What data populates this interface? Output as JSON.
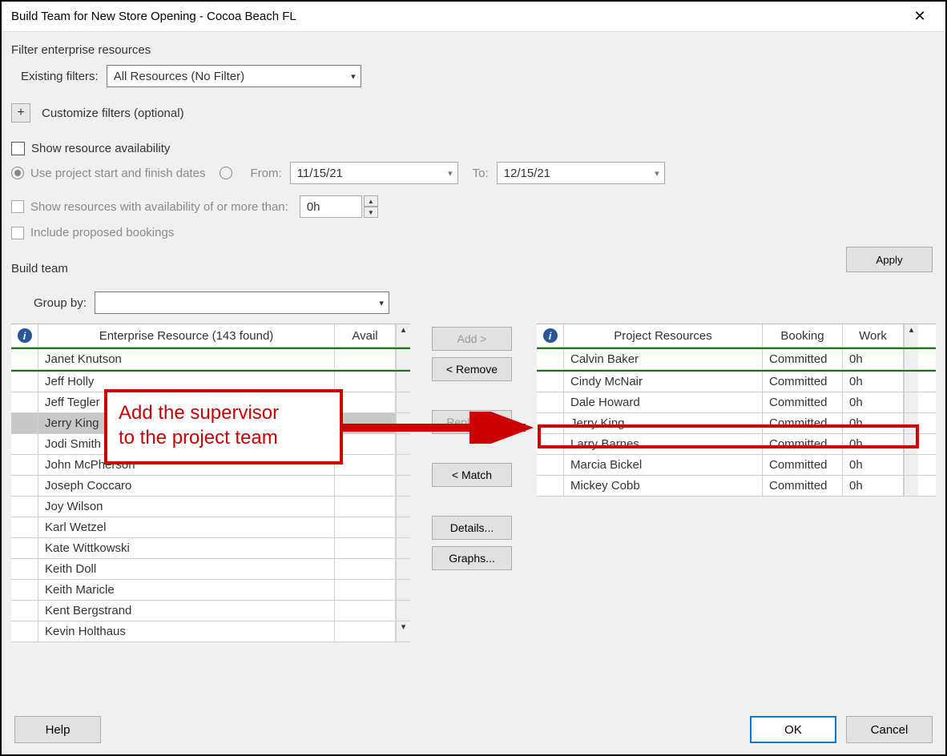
{
  "title": "Build Team for New Store Opening - Cocoa Beach FL",
  "filter_section": {
    "label": "Filter enterprise resources",
    "existing_label": "Existing filters:",
    "existing_value": "All Resources (No Filter)",
    "customize_label": "Customize filters (optional)"
  },
  "availability": {
    "show_label": "Show resource availability",
    "use_dates_label": "Use project start and finish dates",
    "from_label": "From:",
    "to_label": "To:",
    "from_value": "11/15/21",
    "to_value": "12/15/21",
    "show_more_label": "Show resources with availability of or more than:",
    "more_value": "0h",
    "include_label": "Include proposed bookings",
    "apply": "Apply"
  },
  "build": {
    "label": "Build team",
    "group_label": "Group by:"
  },
  "left_grid": {
    "header_resource": "Enterprise Resource (143 found)",
    "header_avail": "Avail",
    "rows": [
      {
        "name": "Janet Knutson",
        "sel": false
      },
      {
        "name": "Jeff Holly",
        "sel": false
      },
      {
        "name": "Jeff Tegler",
        "sel": false
      },
      {
        "name": "Jerry King",
        "sel": true
      },
      {
        "name": "Jodi Smith",
        "sel": false
      },
      {
        "name": "John McPherson",
        "sel": false
      },
      {
        "name": "Joseph Coccaro",
        "sel": false
      },
      {
        "name": "Joy Wilson",
        "sel": false
      },
      {
        "name": "Karl Wetzel",
        "sel": false
      },
      {
        "name": "Kate Wittkowski",
        "sel": false
      },
      {
        "name": "Keith Doll",
        "sel": false
      },
      {
        "name": "Keith Maricle",
        "sel": false
      },
      {
        "name": "Kent Bergstrand",
        "sel": false
      },
      {
        "name": "Kevin Holthaus",
        "sel": false
      }
    ]
  },
  "mid_buttons": {
    "add": "Add >",
    "remove": "< Remove",
    "replace": "Replace >",
    "match": "< Match",
    "details": "Details...",
    "graphs": "Graphs..."
  },
  "right_grid": {
    "header_resource": "Project Resources",
    "header_book": "Booking",
    "header_work": "Work",
    "rows": [
      {
        "name": "Calvin Baker",
        "book": "Committed",
        "work": "0h"
      },
      {
        "name": "Cindy McNair",
        "book": "Committed",
        "work": "0h"
      },
      {
        "name": "Dale Howard",
        "book": "Committed",
        "work": "0h"
      },
      {
        "name": "Jerry King",
        "book": "Committed",
        "work": "0h"
      },
      {
        "name": "Larry Barnes",
        "book": "Committed",
        "work": "0h"
      },
      {
        "name": "Marcia Bickel",
        "book": "Committed",
        "work": "0h"
      },
      {
        "name": "Mickey Cobb",
        "book": "Committed",
        "work": "0h"
      }
    ]
  },
  "callout": {
    "line1": "Add the supervisor",
    "line2": "to the project team"
  },
  "footer": {
    "help": "Help",
    "ok": "OK",
    "cancel": "Cancel"
  }
}
